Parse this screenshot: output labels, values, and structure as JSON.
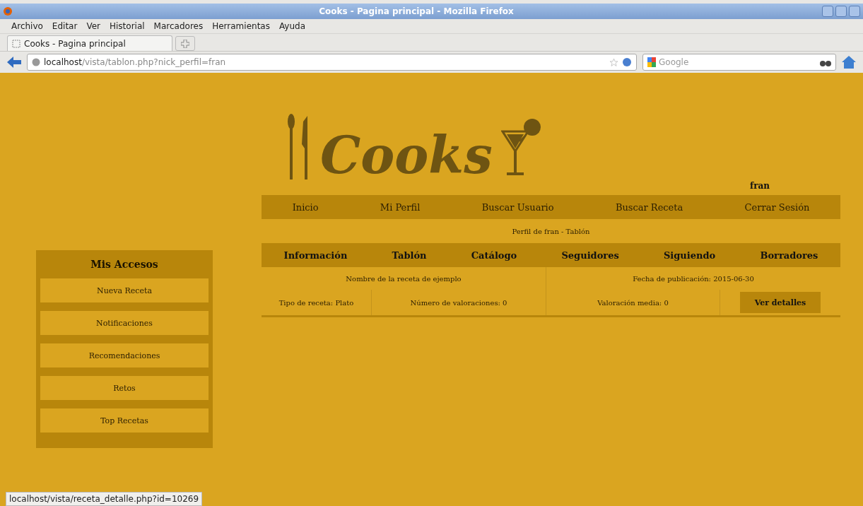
{
  "window": {
    "title": "Cooks - Pagina principal - Mozilla Firefox"
  },
  "menu": [
    "Archivo",
    "Editar",
    "Ver",
    "Historial",
    "Marcadores",
    "Herramientas",
    "Ayuda"
  ],
  "tabs": [
    {
      "label": "Cooks - Pagina principal",
      "selected": true
    }
  ],
  "address_bar": {
    "host": "localhost",
    "path": "/vista/tablon.php?nick_perfil=fran"
  },
  "search": {
    "placeholder": "Google"
  },
  "page": {
    "logo": "Cooks",
    "user": "fran",
    "nav": [
      "Inicio",
      "Mi Perfil",
      "Buscar Usuario",
      "Buscar Receta",
      "Cerrar Sesión"
    ],
    "profile_heading": "Perfil de fran - Tablón",
    "profile_tabs": [
      "Información",
      "Tablón",
      "Catálogo",
      "Seguidores",
      "Siguiendo",
      "Borradores"
    ],
    "recipe": {
      "name": "Nombre de la receta de ejemplo",
      "date": "Fecha de publicación: 2015-06-30",
      "type": "Tipo de receta: Plato",
      "ratings": "Número de valoraciones: 0",
      "average": "Valoración media: 0",
      "button": "Ver detalles"
    },
    "sidebar": {
      "title": "Mis Accesos",
      "items": [
        "Nueva Receta",
        "Notificaciones",
        "Recomendaciones",
        "Retos",
        "Top Recetas"
      ]
    }
  },
  "status_bar": "localhost/vista/receta_detalle.php?id=10269"
}
